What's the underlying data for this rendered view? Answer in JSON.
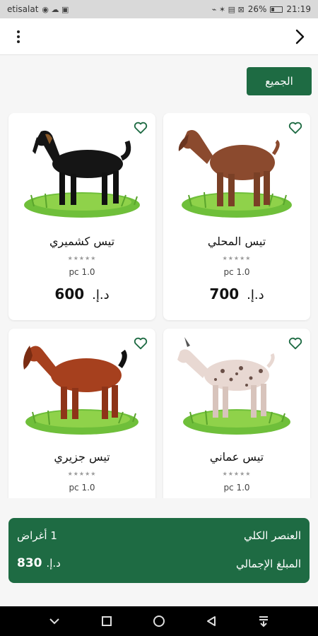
{
  "status_bar": {
    "carrier": "etisalat",
    "battery": "26%",
    "time": "21:19"
  },
  "toolbar": {
    "filter_label": "الجميع"
  },
  "products": [
    {
      "name": "تيس المحلي",
      "stars": "★★★★★",
      "unit": "pc 1.0",
      "price": "700",
      "currency": "د.إ."
    },
    {
      "name": "تيس كشميري",
      "stars": "★★★★★",
      "unit": "pc 1.0",
      "price": "600",
      "currency": "د.إ."
    },
    {
      "name": "تيس عماني",
      "stars": "★★★★★",
      "unit": "pc 1.0",
      "price": "",
      "currency": ""
    },
    {
      "name": "تيس جزيري",
      "stars": "★★★★★",
      "unit": "pc 1.0",
      "price": "",
      "currency": ""
    }
  ],
  "summary": {
    "items_label": "العنصر الكلي",
    "items_value": "1 أغراض",
    "total_label": "المبلغ الإجمالي",
    "total_amount": "830",
    "total_currency": "د.إ."
  },
  "colors": {
    "accent": "#1e6b43",
    "heart": "#1e6b43"
  },
  "icons": {
    "menu": "more-vert-icon",
    "back": "chevron-right-icon",
    "favorite": "heart-outline-icon"
  }
}
